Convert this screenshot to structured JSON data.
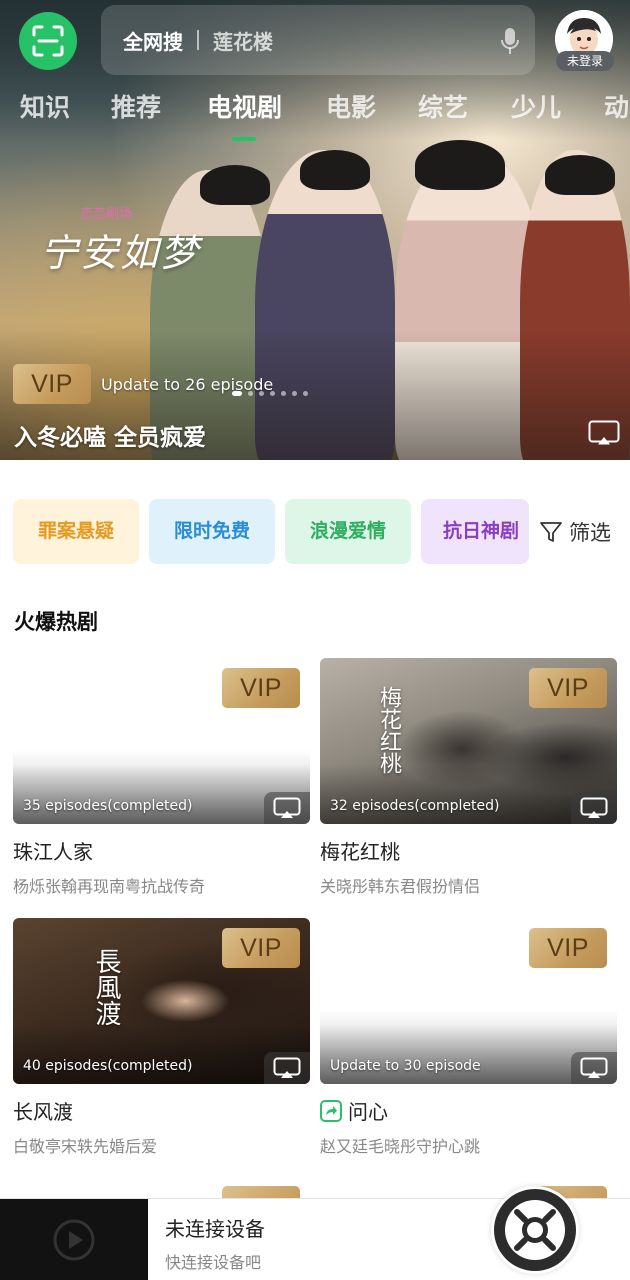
{
  "header": {
    "search_scope": "全网搜",
    "search_placeholder": "莲花楼",
    "login_label": "未登录"
  },
  "tabs": [
    {
      "label": "知识",
      "active": false
    },
    {
      "label": "推荐",
      "active": false
    },
    {
      "label": "电视剧",
      "active": true
    },
    {
      "label": "电影",
      "active": false
    },
    {
      "label": "综艺",
      "active": false
    },
    {
      "label": "少儿",
      "active": false
    },
    {
      "label": "动",
      "active": false
    }
  ],
  "banner": {
    "logo_tag": "恋恋剧场",
    "logo_title": "宁安如梦",
    "vip_label": "VIP",
    "update_text": "Update to 26 episode",
    "title": "入冬必嗑 全员疯爱"
  },
  "chips": [
    {
      "label": "罪案悬疑",
      "color": "#e69a1f"
    },
    {
      "label": "限时免费",
      "color": "#2a8ed3"
    },
    {
      "label": "浪漫爱情",
      "color": "#2fae5f"
    },
    {
      "label": "抗日神剧",
      "color": "#8b3fc0"
    }
  ],
  "filter_label": "筛选",
  "section": {
    "title": "火爆热剧",
    "cards": [
      {
        "title": "珠江人家",
        "subtitle": "杨烁张翰再现南粤抗战传奇",
        "episodes": "35 episodes(completed)",
        "vip": "VIP"
      },
      {
        "title": "梅花红桃",
        "subtitle": "关晓彤韩东君假扮情侣",
        "episodes": "32 episodes(completed)",
        "vip": "VIP",
        "poster_text": "梅花红桃"
      },
      {
        "title": "长风渡",
        "subtitle": "白敬亭宋轶先婚后爱",
        "episodes": "40 episodes(completed)",
        "vip": "VIP",
        "poster_text": "長風渡"
      },
      {
        "title": "问心",
        "subtitle": "赵又廷毛晓彤守护心跳",
        "episodes": "Update to 30 episode",
        "vip": "VIP"
      }
    ]
  },
  "player": {
    "title": "未连接设备",
    "subtitle": "快连接设备吧"
  },
  "colors": {
    "accent": "#27c267",
    "vip_gold": "#c59c5e"
  }
}
